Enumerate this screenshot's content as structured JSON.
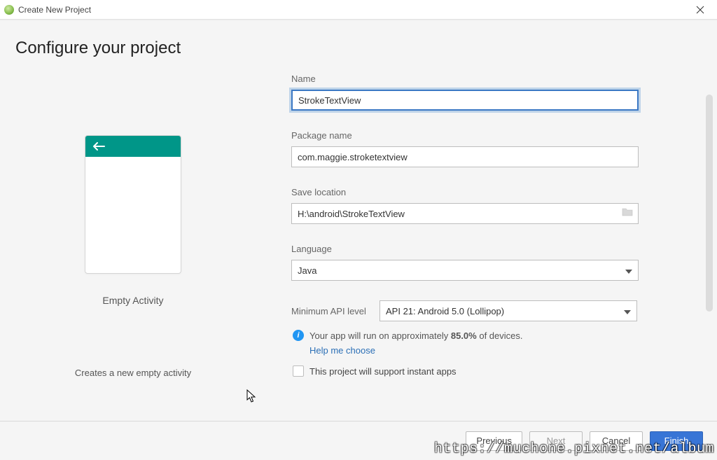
{
  "window": {
    "title": "Create New Project"
  },
  "page": {
    "heading": "Configure your project"
  },
  "preview": {
    "template_name": "Empty Activity",
    "description": "Creates a new empty activity"
  },
  "form": {
    "name_label": "Name",
    "name_value": "StrokeTextView",
    "package_label": "Package name",
    "package_value": "com.maggie.stroketextview",
    "location_label": "Save location",
    "location_value": "H:\\android\\StrokeTextView",
    "language_label": "Language",
    "language_value": "Java",
    "api_label": "Minimum API level",
    "api_value": "API 21: Android 5.0 (Lollipop)",
    "info_prefix": "Your app will run on approximately ",
    "info_pct": "85.0%",
    "info_suffix": " of devices.",
    "help_link": "Help me choose",
    "instant_apps_label": "This project will support instant apps"
  },
  "buttons": {
    "previous": "Previous",
    "next": "Next",
    "cancel": "Cancel",
    "finish": "Finish"
  },
  "watermark": "https://muchone.pixnet.net/album"
}
